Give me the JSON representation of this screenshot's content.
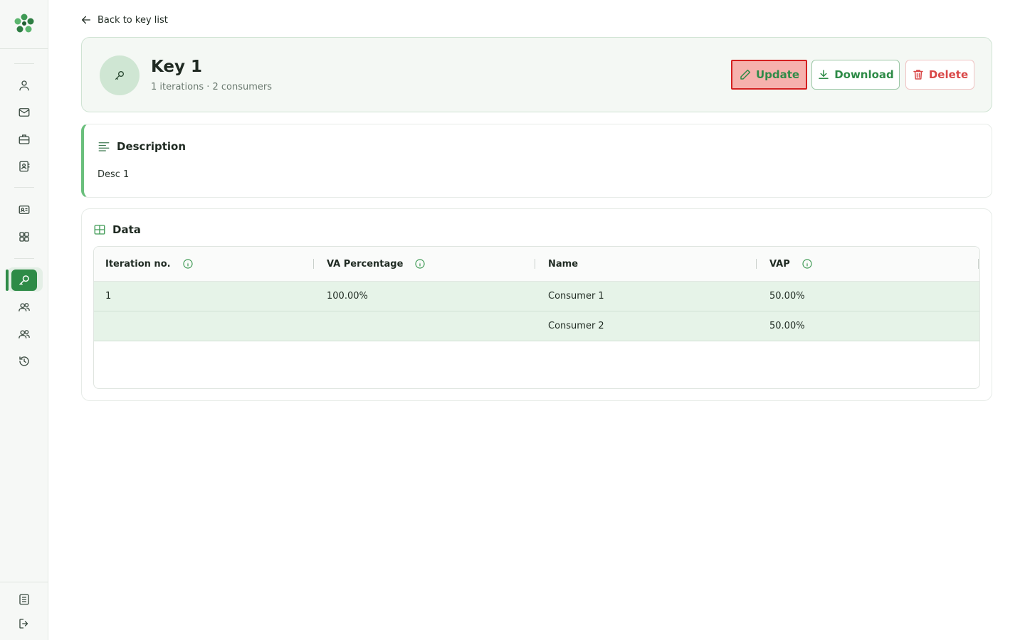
{
  "nav": {
    "back_label": "Back to key list"
  },
  "key": {
    "title": "Key 1",
    "subtitle": "1 iterations · 2 consumers"
  },
  "actions": {
    "update_label": "Update",
    "download_label": "Download",
    "delete_label": "Delete"
  },
  "description": {
    "heading": "Description",
    "text": "Desc 1"
  },
  "data_section": {
    "heading": "Data",
    "columns": [
      "Iteration no.",
      "VA Percentage",
      "Name",
      "VAP"
    ],
    "rows": [
      [
        "1",
        "100.00%",
        "Consumer 1",
        "50.00%"
      ],
      [
        "",
        "",
        "Consumer 2",
        "50.00%"
      ]
    ]
  },
  "colors": {
    "accent": "#2e8b47",
    "danger": "#d94848",
    "highlight_row": "#e6f3e8"
  },
  "sidebar_icons": [
    "user-icon",
    "mail-icon",
    "briefcase-icon",
    "contact-book-icon",
    "id-card-icon",
    "grid-icon",
    "key-icon",
    "users-icon",
    "users-alt-icon",
    "history-icon",
    "document-icon",
    "logout-icon"
  ]
}
